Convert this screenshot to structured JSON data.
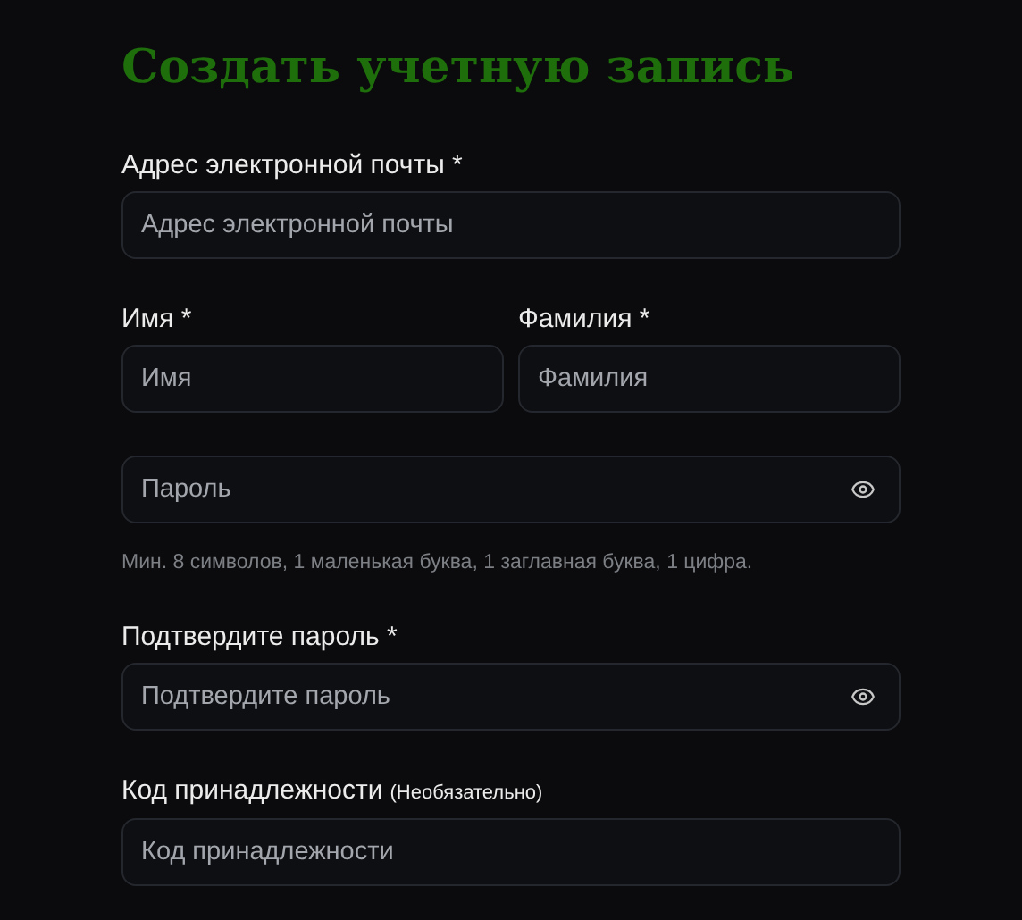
{
  "title": "Создать учетную запись",
  "rows": [
    {
      "fields": [
        {
          "kind": "text",
          "label": "Адрес электронной почты *",
          "placeholder": "Адрес электронной почты"
        }
      ]
    },
    {
      "fields": [
        {
          "kind": "text",
          "label": "Имя *",
          "placeholder": "Имя"
        },
        {
          "kind": "text",
          "label": "Фамилия *",
          "placeholder": "Фамилия"
        }
      ]
    },
    {
      "fields": [
        {
          "kind": "password",
          "placeholder": "Пароль"
        }
      ],
      "hint": "Мин. 8 символов, 1 маленькая буква, 1 заглавная буква, 1 цифра."
    },
    {
      "fields": [
        {
          "kind": "password",
          "label": "Подтвердите пароль *",
          "placeholder": "Подтвердите пароль"
        }
      ]
    },
    {
      "fields": [
        {
          "kind": "text",
          "label": "Код принадлежности",
          "note": "(Необязательно)",
          "placeholder": "Код принадлежности"
        }
      ]
    }
  ]
}
